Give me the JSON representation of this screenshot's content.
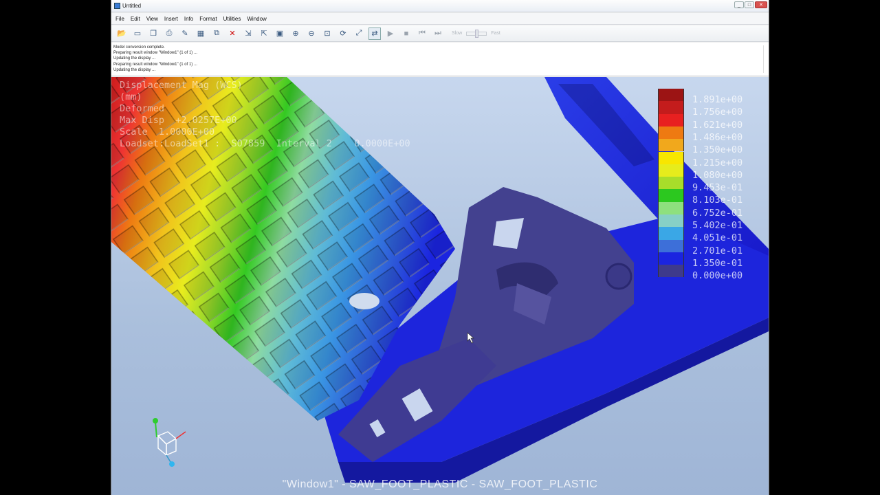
{
  "window": {
    "title": "Untitled",
    "controls": [
      "_",
      "□",
      "✕"
    ]
  },
  "menu": [
    "File",
    "Edit",
    "View",
    "Insert",
    "Info",
    "Format",
    "Utilities",
    "Window"
  ],
  "toolbar": {
    "speed_slow": "Slow",
    "speed_fast": "Fast"
  },
  "log": [
    "Model conversion complete.",
    "Preparing result window \"Window1\" (1 of 1) ...",
    "Updating the display ...",
    "Preparing result window \"Window1\" (1 of 1) ...",
    "Updating the display ..."
  ],
  "viewport": {
    "info": [
      "Displacement Mag (WCS)",
      "(mm)",
      "Deformed",
      "Max Disp  +2.0257E+00",
      "Scale  1.0000E+00",
      "Loadset:LoadSet1 :  SO7859  Interval 2    0.0000E+00"
    ],
    "footer": "\"Window1\" - SAW_FOOT_PLASTIC - SAW_FOOT_PLASTIC",
    "legend": [
      {
        "value": "1.891e+00",
        "color": "#9c1414"
      },
      {
        "value": "1.756e+00",
        "color": "#c41c1c"
      },
      {
        "value": "1.621e+00",
        "color": "#e82020"
      },
      {
        "value": "1.486e+00",
        "color": "#ee7a12"
      },
      {
        "value": "1.350e+00",
        "color": "#f1a81c"
      },
      {
        "value": "1.215e+00",
        "color": "#f8e600"
      },
      {
        "value": "1.080e+00",
        "color": "#e6ec1c"
      },
      {
        "value": "9.453e-01",
        "color": "#a8dd2a"
      },
      {
        "value": "8.103e-01",
        "color": "#2cc81f"
      },
      {
        "value": "6.752e-01",
        "color": "#8ee07e"
      },
      {
        "value": "5.402e-01",
        "color": "#86d0c6"
      },
      {
        "value": "4.051e-01",
        "color": "#3aa7e6"
      },
      {
        "value": "2.701e-01",
        "color": "#3d6fd9"
      },
      {
        "value": "1.350e-01",
        "color": "#1b24e0"
      },
      {
        "value": "0.000e+00",
        "color": "#3e3a8c"
      }
    ]
  }
}
